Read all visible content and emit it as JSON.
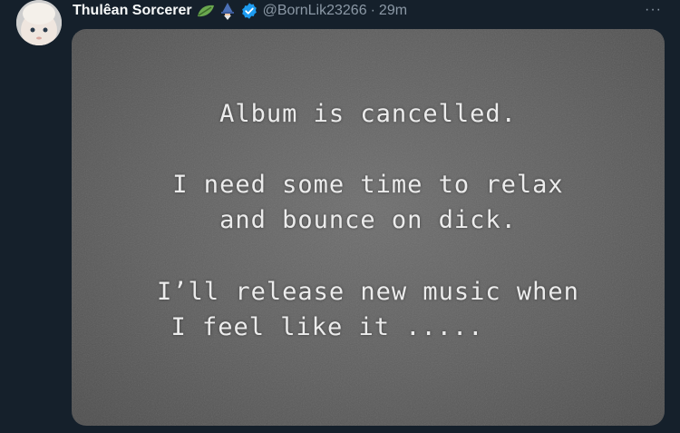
{
  "tweet": {
    "display_name": "Thulêan Sorcerer",
    "handle": "@BornLik23266",
    "separator": "·",
    "time": "29m",
    "more_label": "···",
    "emojis": [
      "leaf-icon",
      "wizard-icon"
    ],
    "verified_icon": "verified-badge-icon",
    "media": {
      "lines": [
        "Album is cancelled.",
        "I need some time to relax",
        "and bounce on dick.",
        "I’ll release new music when",
        "I feel like it ....."
      ]
    }
  },
  "colors": {
    "background": "#15202b",
    "name": "#f7f9f9",
    "secondary_text": "#8b98a5",
    "verified": "#1d9bf0",
    "media_bg": "#5e5e5e"
  }
}
